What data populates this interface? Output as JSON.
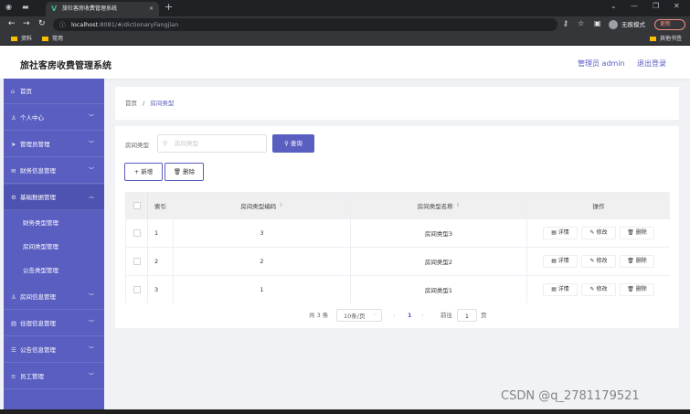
{
  "browser": {
    "tab_title": "旅社客房收费管理系统",
    "url_host": "localhost",
    "url_path": ":8081/#/dictionaryFangjian",
    "incognito_label": "无痕模式",
    "update_label": "更新",
    "bookmarks": [
      "资料",
      "常用"
    ],
    "bookmarks_right": "其他书签"
  },
  "header": {
    "title": "旅社客房收费管理系统",
    "admin": "管理员 admin",
    "logout": "退出登录"
  },
  "sidebar": {
    "items": [
      {
        "label": "首页",
        "icon": "home-icon",
        "expandable": false
      },
      {
        "label": "个人中心",
        "icon": "user-icon",
        "expandable": true
      },
      {
        "label": "管理员管理",
        "icon": "send-icon",
        "expandable": true
      },
      {
        "label": "财务信息管理",
        "icon": "mail-icon",
        "expandable": true
      },
      {
        "label": "基础数据管理",
        "icon": "gear-icon",
        "expandable": true,
        "expanded": true
      },
      {
        "label": "房间信息管理",
        "icon": "user-icon",
        "expandable": true
      },
      {
        "label": "住宿信息管理",
        "icon": "doc-icon",
        "expandable": true
      },
      {
        "label": "公告信息管理",
        "icon": "list-icon",
        "expandable": true
      },
      {
        "label": "员工管理",
        "icon": "menu-icon",
        "expandable": true
      }
    ],
    "subitems": [
      "财务类型管理",
      "房间类型管理",
      "公告类型管理"
    ]
  },
  "breadcrumb": {
    "home": "首页",
    "sep": "/",
    "current": "房间类型"
  },
  "search": {
    "label": "房间类型",
    "placeholder": "房间类型",
    "button": "查询"
  },
  "actions": {
    "add": "新增",
    "delete": "删除"
  },
  "table": {
    "columns": {
      "index": "索引",
      "code": "房间类型编码",
      "name": "房间类型名称",
      "ops": "操作"
    },
    "rows": [
      {
        "index": "1",
        "code": "3",
        "name": "房间类型3"
      },
      {
        "index": "2",
        "code": "2",
        "name": "房间类型2"
      },
      {
        "index": "3",
        "code": "1",
        "name": "房间类型1"
      }
    ],
    "op_labels": {
      "detail": "详情",
      "edit": "修改",
      "delete": "删除"
    }
  },
  "pagination": {
    "total": "共 3 条",
    "page_size": "10条/页",
    "current_page": "1",
    "goto_label": "前往",
    "goto_value": "1",
    "page_unit": "页"
  },
  "watermark": "CSDN @q_2781179521"
}
